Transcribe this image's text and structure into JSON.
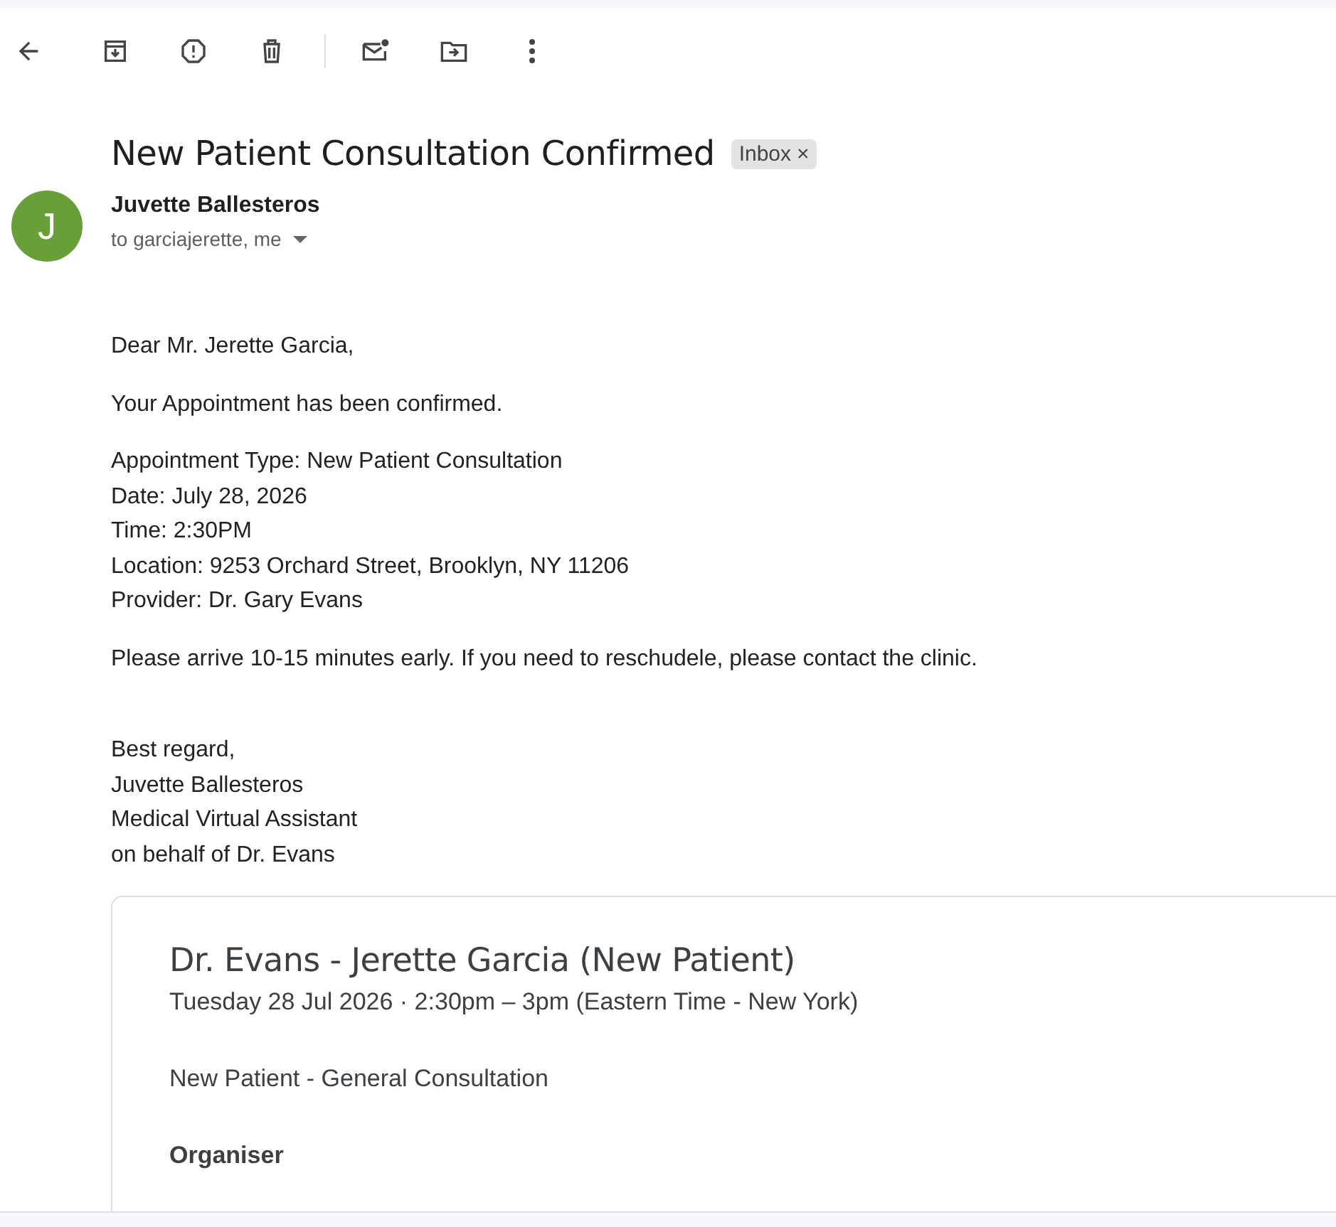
{
  "subject": "New Patient Consultation Confirmed",
  "label": {
    "text": "Inbox",
    "close": "×"
  },
  "sender": {
    "initial": "J",
    "name": "Juvette Ballesteros",
    "recipients": "to garciajerette, me"
  },
  "body": [
    [
      "Dear Mr. Jerette Garcia,"
    ],
    [
      "Your Appointment has been confirmed."
    ],
    [
      "Appointment Type: New Patient Consultation",
      "Date: July 28, 2026",
      "Time: 2:30PM",
      "Location: 9253 Orchard Street, Brooklyn, NY 11206",
      "Provider: Dr. Gary Evans"
    ],
    [
      "Please arrive 10-15 minutes early. If you need to reschudele, please contact the clinic."
    ],
    [
      "Best regard,",
      "Juvette Ballesteros",
      "Medical Virtual Assistant",
      "on behalf of Dr. Evans"
    ]
  ],
  "event": {
    "title": "Dr. Evans - Jerette Garcia (New Patient)",
    "when": "Tuesday 28 Jul 2026 · 2:30pm – 3pm (Eastern Time - New York)",
    "description": "New Patient - General Consultation",
    "organiser_heading": "Organiser"
  }
}
